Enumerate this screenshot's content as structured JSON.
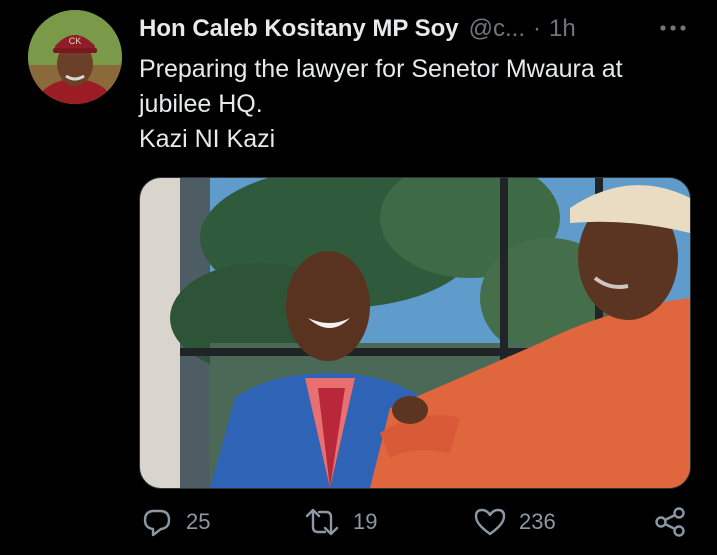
{
  "tweet": {
    "author_name": "Hon Caleb Kositany MP Soy",
    "handle": "@c...",
    "separator": "·",
    "time": "1h",
    "text_lines": [
      "Preparing the lawyer for Senetor Mwaura at",
      "jubilee HQ.",
      "Kazi NI Kazi"
    ],
    "avatar_cap_text": "CK"
  },
  "actions": {
    "reply_count": "25",
    "retweet_count": "19",
    "like_count": "236"
  },
  "icons": [
    "more-icon",
    "reply-icon",
    "retweet-icon",
    "like-icon",
    "share-icon"
  ],
  "colors": {
    "background": "#000000",
    "primary_text": "#e7e9ea",
    "secondary_text": "#71767b"
  }
}
